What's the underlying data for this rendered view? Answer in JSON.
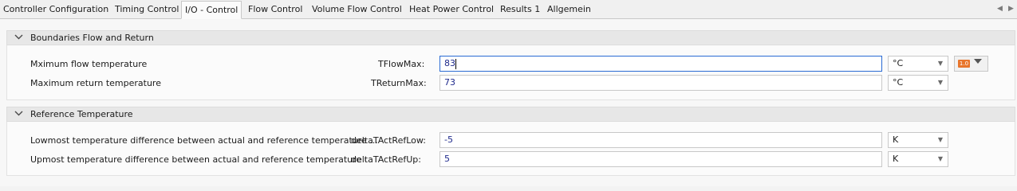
{
  "tabs": [
    {
      "label": "Controller Configuration",
      "active": false
    },
    {
      "label": "Timing Control",
      "active": false
    },
    {
      "label": "I/O - Control",
      "active": true
    },
    {
      "label": "Flow Control",
      "active": false
    },
    {
      "label": "Volume Flow Control",
      "active": false
    },
    {
      "label": "Heat Power Control",
      "active": false
    },
    {
      "label": "Results 1",
      "active": false
    },
    {
      "label": "Allgemein",
      "active": false
    }
  ],
  "tab_scroll": {
    "left_icon": "triangle-left",
    "right_icon": "triangle-right"
  },
  "groups": [
    {
      "title": "Boundaries Flow and Return",
      "rows": [
        {
          "description": "Mximum flow temperature",
          "param": "TFlowMax:",
          "value": "83",
          "unit": "°C"
        },
        {
          "description": "Maximum return temperature",
          "param": "TReturnMax:",
          "value": "73",
          "unit": "°C"
        }
      ],
      "badge": {
        "text": "1.0",
        "icon": "value-badge-icon"
      }
    },
    {
      "title": "Reference Temperature",
      "rows": [
        {
          "description": "Lowmost temperature difference between actual and reference temperature ...",
          "param": "deltaTActRefLow:",
          "value": "-5",
          "unit": "K"
        },
        {
          "description": "Upmost temperature difference between actual and reference temperature (<...",
          "param": "deltaTActRefUp:",
          "value": "5",
          "unit": "K"
        }
      ]
    }
  ],
  "colors": {
    "badge": "#e8752b",
    "focus_border": "#2a6ad3",
    "value_text": "#1f2a8c"
  }
}
